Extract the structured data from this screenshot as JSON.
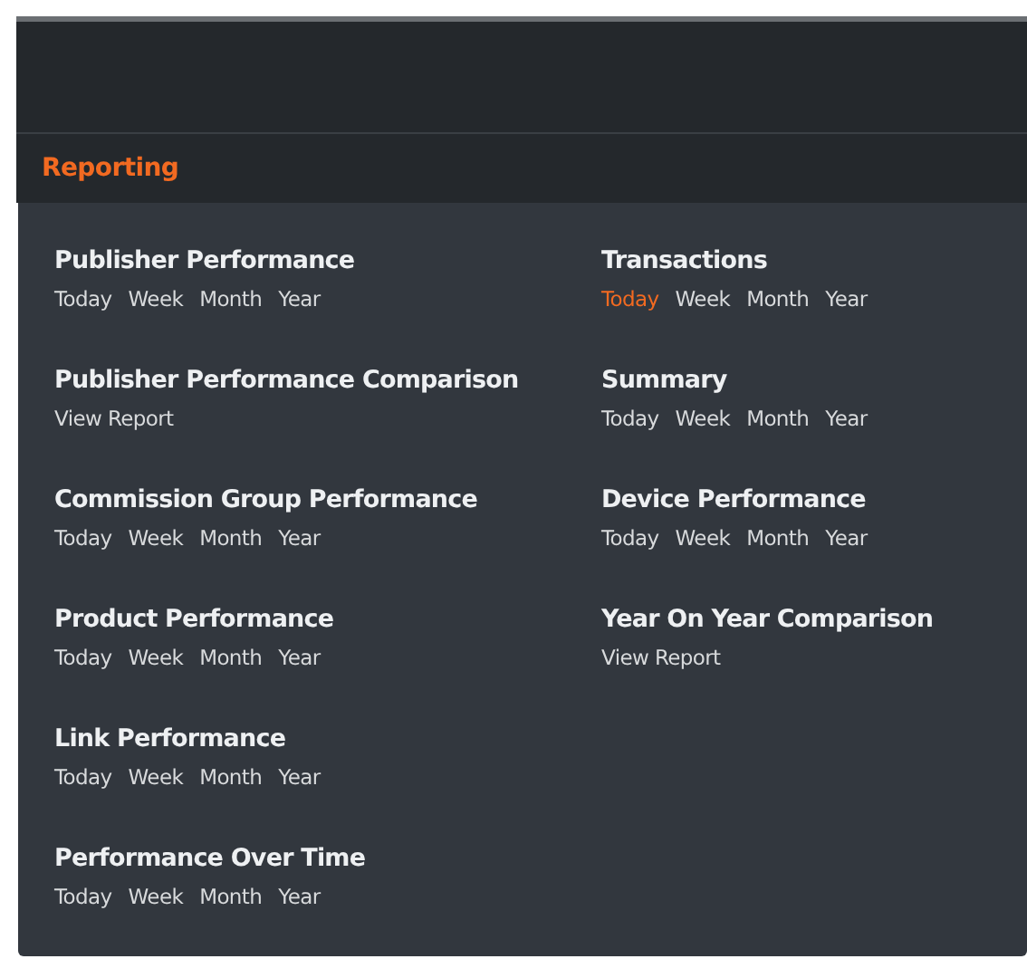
{
  "menu": {
    "title": "Reporting",
    "selected": true
  },
  "columns": [
    [
      {
        "title": "Publisher Performance",
        "links": [
          {
            "label": "Today",
            "selected": false
          },
          {
            "label": "Week",
            "selected": false
          },
          {
            "label": "Month",
            "selected": false
          },
          {
            "label": "Year",
            "selected": false
          }
        ]
      },
      {
        "title": "Publisher Performance Comparison",
        "links": [
          {
            "label": "View Report",
            "selected": false
          }
        ]
      },
      {
        "title": "Commission Group Performance",
        "links": [
          {
            "label": "Today",
            "selected": false
          },
          {
            "label": "Week",
            "selected": false
          },
          {
            "label": "Month",
            "selected": false
          },
          {
            "label": "Year",
            "selected": false
          }
        ]
      },
      {
        "title": "Product Performance",
        "links": [
          {
            "label": "Today",
            "selected": false
          },
          {
            "label": "Week",
            "selected": false
          },
          {
            "label": "Month",
            "selected": false
          },
          {
            "label": "Year",
            "selected": false
          }
        ]
      },
      {
        "title": "Link Performance",
        "links": [
          {
            "label": "Today",
            "selected": false
          },
          {
            "label": "Week",
            "selected": false
          },
          {
            "label": "Month",
            "selected": false
          },
          {
            "label": "Year",
            "selected": false
          }
        ]
      },
      {
        "title": "Performance Over Time",
        "links": [
          {
            "label": "Today",
            "selected": false
          },
          {
            "label": "Week",
            "selected": false
          },
          {
            "label": "Month",
            "selected": false
          },
          {
            "label": "Year",
            "selected": false
          }
        ]
      }
    ],
    [
      {
        "title": "Transactions",
        "links": [
          {
            "label": "Today",
            "selected": true
          },
          {
            "label": "Week",
            "selected": false
          },
          {
            "label": "Month",
            "selected": false
          },
          {
            "label": "Year",
            "selected": false
          }
        ]
      },
      {
        "title": "Summary",
        "links": [
          {
            "label": "Today",
            "selected": false
          },
          {
            "label": "Week",
            "selected": false
          },
          {
            "label": "Month",
            "selected": false
          },
          {
            "label": "Year",
            "selected": false
          }
        ]
      },
      {
        "title": "Device Performance",
        "links": [
          {
            "label": "Today",
            "selected": false
          },
          {
            "label": "Week",
            "selected": false
          },
          {
            "label": "Month",
            "selected": false
          },
          {
            "label": "Year",
            "selected": false
          }
        ]
      },
      {
        "title": "Year On Year Comparison",
        "links": [
          {
            "label": "View Report",
            "selected": false
          }
        ]
      }
    ]
  ]
}
